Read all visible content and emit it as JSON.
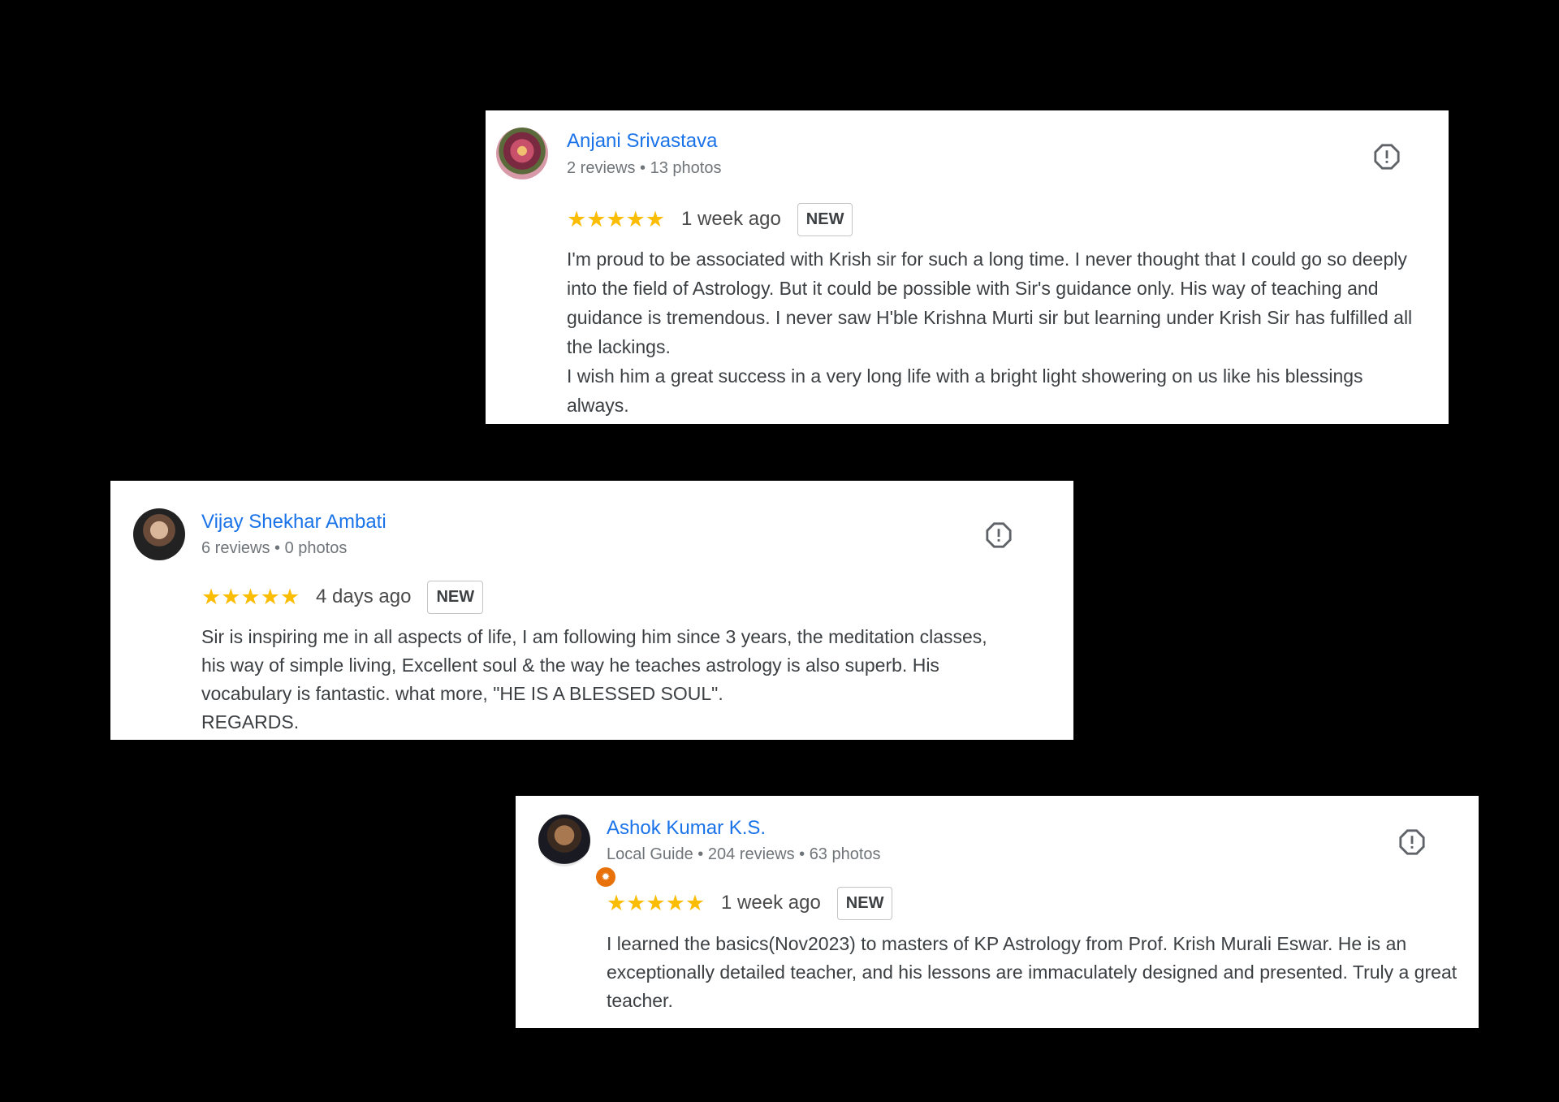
{
  "reviews": [
    {
      "author": "Anjani Srivastava",
      "meta": "2 reviews • 13 photos",
      "rating": 5,
      "stars": "★★★★★",
      "time": "1 week ago",
      "badge": "NEW",
      "text": "I'm proud to be associated with Krish sir for such a long time. I never thought that I could go so deeply into the field of Astrology. But it could be possible with Sir's guidance only. His way of teaching and guidance is tremendous. I never saw H'ble Krishna Murti sir but learning under Krish Sir has fulfilled all the lackings.\nI wish him a great success in a very long life with a bright light showering on us like his blessings always."
    },
    {
      "author": "Vijay Shekhar Ambati",
      "meta": "6 reviews • 0 photos",
      "rating": 5,
      "stars": "★★★★★",
      "time": "4 days ago",
      "badge": "NEW",
      "text": "Sir is inspiring me in all aspects of life, I am following him since 3 years, the meditation classes, his way of simple living, Excellent soul & the way he teaches astrology is also superb. His vocabulary is fantastic. what more, \"HE IS A BLESSED SOUL\".\nREGARDS."
    },
    {
      "author": "Ashok Kumar K.S.",
      "meta": "Local Guide • 204 reviews • 63 photos",
      "rating": 5,
      "stars": "★★★★★",
      "time": "1 week ago",
      "badge": "NEW",
      "local_guide_icon": "star-badge-icon",
      "text": "I learned the basics(Nov2023) to masters of KP Astrology from Prof. Krish Murali Eswar. He is an exceptionally detailed teacher, and his lessons are immaculately designed and presented. Truly a great teacher."
    }
  ],
  "icons": {
    "report": "report-flag-icon",
    "star": "star-icon"
  },
  "colors": {
    "background": "#000000",
    "card": "#ffffff",
    "author_link": "#1a73e8",
    "meta": "#70757a",
    "star": "#fbbc04",
    "local_guide_badge": "#e8710a"
  }
}
